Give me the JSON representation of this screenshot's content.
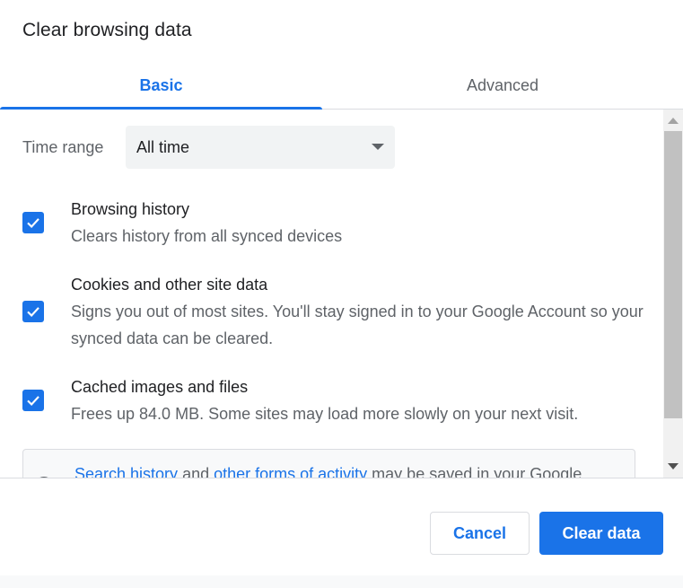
{
  "dialog": {
    "title": "Clear browsing data"
  },
  "tabs": [
    {
      "label": "Basic",
      "selected": true
    },
    {
      "label": "Advanced",
      "selected": false
    }
  ],
  "time_range": {
    "label": "Time range",
    "selected": "All time"
  },
  "options": [
    {
      "title": "Browsing history",
      "description": "Clears history from all synced devices",
      "checked": true
    },
    {
      "title": "Cookies and other site data",
      "description": "Signs you out of most sites. You'll stay signed in to your Google Account so your synced data can be cleared.",
      "checked": true
    },
    {
      "title": "Cached images and files",
      "description": "Frees up 84.0 MB. Some sites may load more slowly on your next visit.",
      "checked": true
    }
  ],
  "info": {
    "link1": "Search history",
    "text1": " and ",
    "link2": "other forms of activity",
    "text2": " may be saved in your Google"
  },
  "buttons": {
    "cancel": "Cancel",
    "clear": "Clear data"
  },
  "colors": {
    "accent": "#1a73e8",
    "text": "#202124",
    "secondary": "#5f6368"
  }
}
